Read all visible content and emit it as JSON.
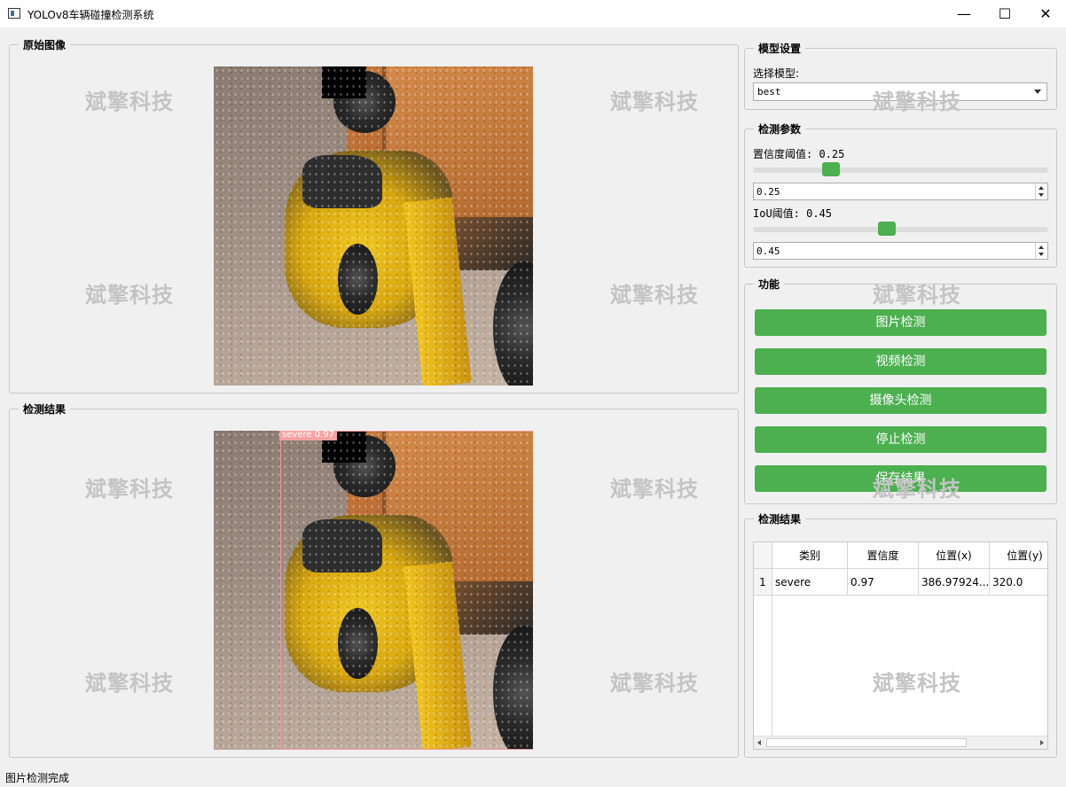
{
  "window": {
    "title": "YOLOv8车辆碰撞检测系统",
    "controls": {
      "minimize": "—",
      "maximize": "☐",
      "close": "✕"
    }
  },
  "panels": {
    "original": {
      "title": "原始图像"
    },
    "result": {
      "title": "检测结果",
      "detection_label": "severe  0.97"
    }
  },
  "model_settings": {
    "title": "模型设置",
    "select_label": "选择模型:",
    "selected_model": "best"
  },
  "detection_params": {
    "title": "检测参数",
    "confidence_label": "置信度阈值: 0.25",
    "confidence_value": "0.25",
    "confidence_fraction": 0.25,
    "iou_label": "IoU阈值: 0.45",
    "iou_value": "0.45",
    "iou_fraction": 0.45
  },
  "functions": {
    "title": "功能",
    "buttons": [
      "图片检测",
      "视频检测",
      "摄像头检测",
      "停止检测",
      "保存结果"
    ]
  },
  "results_table": {
    "title": "检测结果",
    "headers": [
      "类别",
      "置信度",
      "位置(x)",
      "位置(y)"
    ],
    "rows": [
      {
        "index": "1",
        "cells": [
          "severe",
          "0.97",
          "386.97924...",
          "320.0"
        ]
      }
    ]
  },
  "watermark": "斌擎科技",
  "status": "图片检测完成",
  "colors": {
    "accent": "#4caf50",
    "detection_box": "#f29a9a"
  }
}
